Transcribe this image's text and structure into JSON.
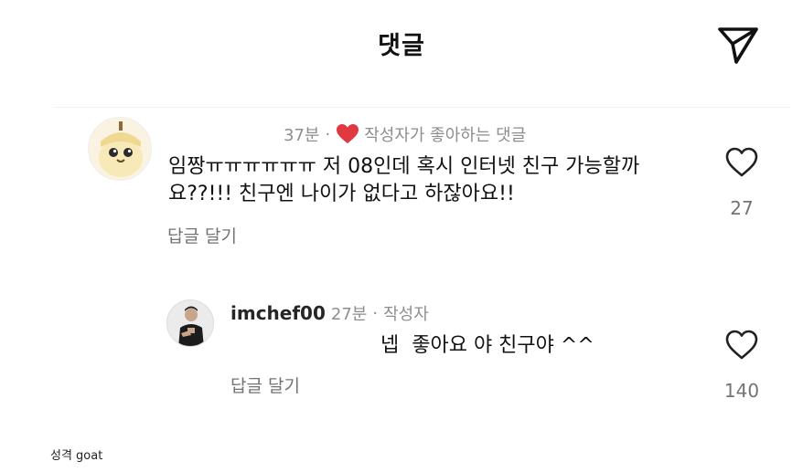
{
  "header": {
    "title": "댓글",
    "send_icon": "paper-plane-icon"
  },
  "comment": {
    "time": "37분",
    "separator": "·",
    "liked_by_author_label": "작성자가 좋아하는 댓글",
    "heart_color": "#e0393f",
    "text": "임짱ㅠㅠㅠㅠㅠㅠ 저 08인데 혹시 인터넷 친구 가능할까요??!!! 친구엔 나이가 없다고 하잖아요!!",
    "reply_label": "답글 달기",
    "like_icon": "heart-outline-icon",
    "like_count": "27"
  },
  "reply": {
    "username": "imchef00",
    "time": "27분",
    "separator": "·",
    "author_badge": "작성자",
    "text": "넵  좋아요 야 친구야 ^^",
    "reply_label": "답글 달기",
    "like_icon": "heart-outline-icon",
    "like_count": "140"
  },
  "caption": "성격 goat"
}
